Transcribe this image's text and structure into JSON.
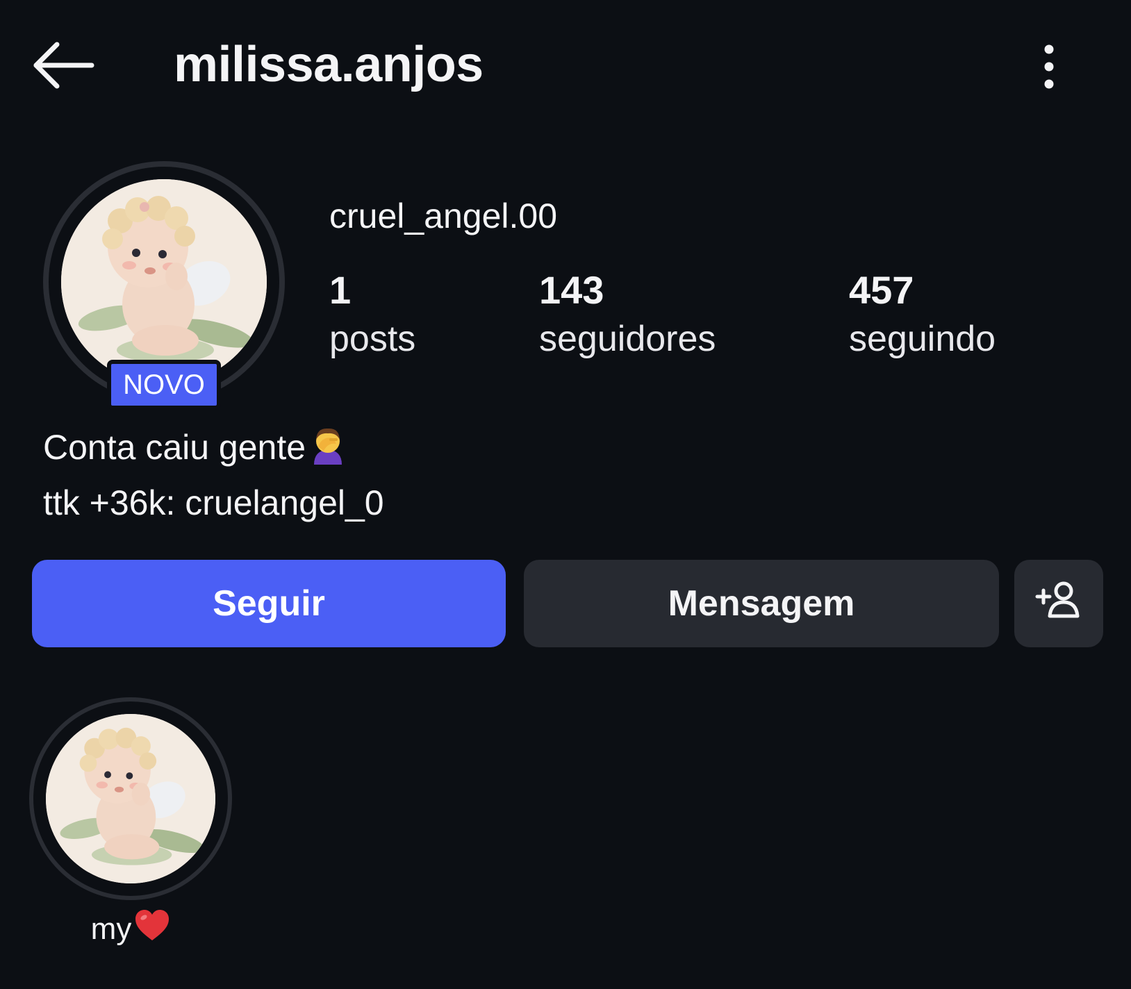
{
  "header": {
    "back_icon": "arrow-left-icon",
    "title": "milissa.anjos",
    "more_icon": "more-vertical-icon"
  },
  "profile": {
    "avatar_icon": "cherub-avatar-image",
    "badge": "NOVO",
    "username": "cruel_angel.00",
    "stats": [
      {
        "value": "1",
        "label": "posts"
      },
      {
        "value": "143",
        "label": "seguidores"
      },
      {
        "value": "457",
        "label": "seguindo"
      }
    ],
    "bio": {
      "line1": "Conta caiu gente",
      "line1_emoji": "face-palm-emoji",
      "line2": "ttk +36k: cruelangel_0"
    }
  },
  "actions": {
    "follow_label": "Seguir",
    "message_label": "Mensagem",
    "add_user_icon": "add-user-icon"
  },
  "highlights": [
    {
      "label": "my",
      "emoji": "red-heart-emoji"
    }
  ],
  "colors": {
    "background": "#0c0f14",
    "accent": "#4b5ff5",
    "button_dark": "#272a31",
    "ring": "#2a2d34",
    "text": "#f4f4f6"
  }
}
